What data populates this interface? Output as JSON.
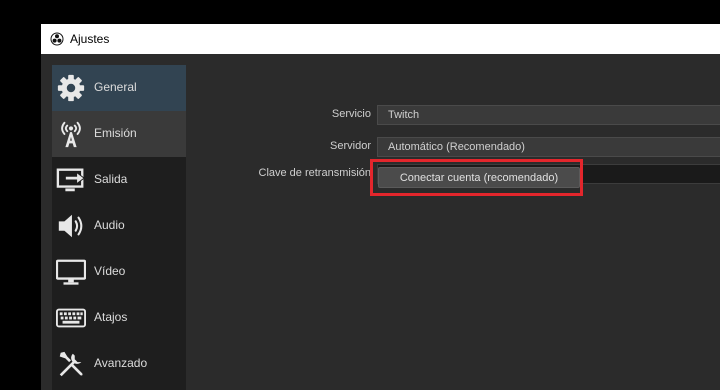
{
  "window": {
    "title": "Ajustes"
  },
  "sidebar": {
    "items": [
      {
        "label": "General",
        "icon": "gear-icon"
      },
      {
        "label": "Emisión",
        "icon": "broadcast-icon"
      },
      {
        "label": "Salida",
        "icon": "output-icon"
      },
      {
        "label": "Audio",
        "icon": "speaker-icon"
      },
      {
        "label": "Vídeo",
        "icon": "monitor-icon"
      },
      {
        "label": "Atajos",
        "icon": "keyboard-icon"
      },
      {
        "label": "Avanzado",
        "icon": "tools-icon"
      }
    ]
  },
  "form": {
    "service_label": "Servicio",
    "service_value": "Twitch",
    "server_label": "Servidor",
    "server_value": "Automático (Recomendado)",
    "key_label": "Clave de retransmisión",
    "key_value": "",
    "connect_button": "Conectar cuenta (recomendado)"
  },
  "colors": {
    "highlight_border": "#e3262c",
    "sidebar_background": "#1e1e1e",
    "panel_background": "#2b2b2b"
  }
}
